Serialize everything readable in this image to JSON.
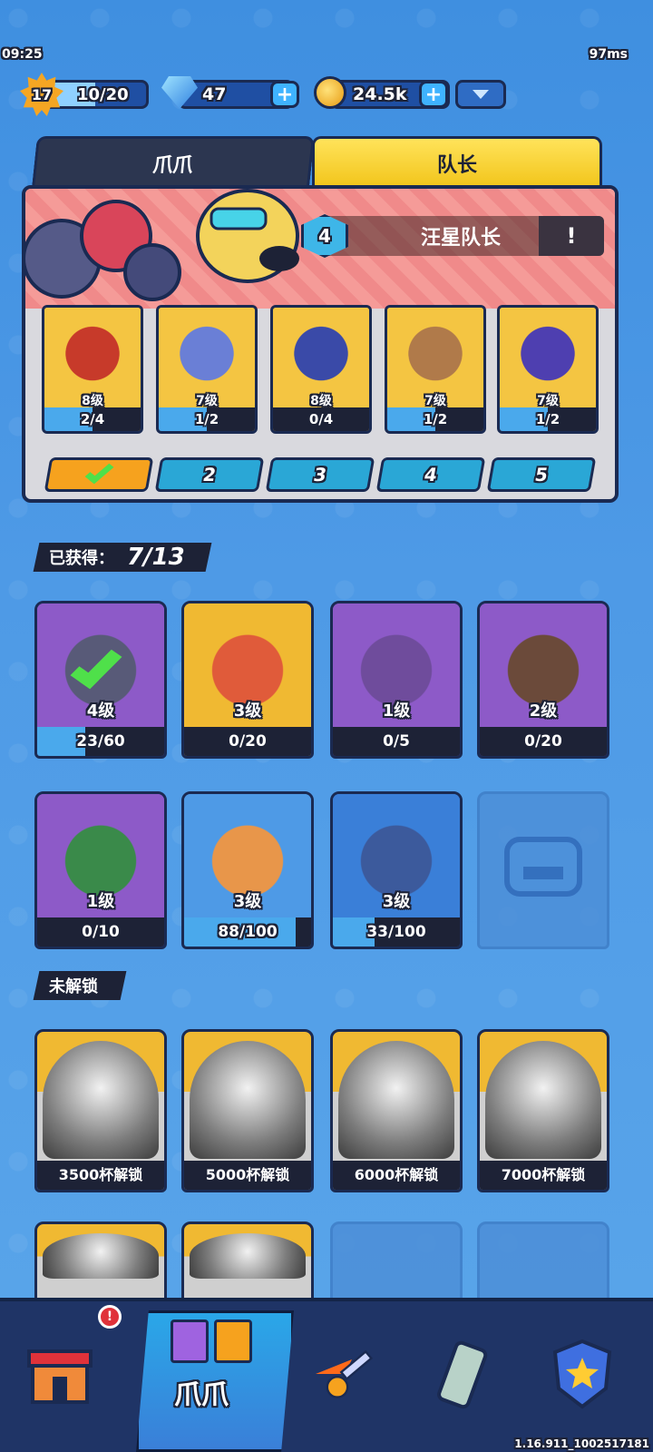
{
  "status": {
    "time": "09:25",
    "ping": "97ms"
  },
  "topbar": {
    "level": "17",
    "xp": "10/20",
    "xp_fraction": 0.5,
    "gems": "47",
    "coins": "24.5k"
  },
  "tabs": {
    "claw": "爪爪",
    "captain": "队长"
  },
  "captain": {
    "badge": "4",
    "name": "汪星队长",
    "info": "!"
  },
  "squad": [
    {
      "level": "8级",
      "progress": "2/4",
      "fraction": 0.5,
      "color": "#c73a2a"
    },
    {
      "level": "7级",
      "progress": "1/2",
      "fraction": 0.5,
      "color": "#6a7fd6"
    },
    {
      "level": "8级",
      "progress": "0/4",
      "fraction": 0.0,
      "color": "#3a4aa8"
    },
    {
      "level": "7级",
      "progress": "1/2",
      "fraction": 0.5,
      "color": "#b07a4a"
    },
    {
      "level": "7级",
      "progress": "1/2",
      "fraction": 0.5,
      "color": "#4e3fb0"
    }
  ],
  "slots": [
    "",
    "2",
    "3",
    "4",
    "5"
  ],
  "owned": {
    "label": "已获得：",
    "count": "7/13",
    "cards": [
      {
        "level": "4级",
        "progress": "23/60",
        "fraction": 0.38,
        "top": "#8d5ac8",
        "art": "#585a78"
      },
      {
        "level": "3级",
        "progress": "0/20",
        "fraction": 0.0,
        "top": "#f0b932",
        "art": "#e05b3a"
      },
      {
        "level": "1级",
        "progress": "0/5",
        "fraction": 0.0,
        "top": "#8d5ac8",
        "art": "#6f4c9c"
      },
      {
        "level": "2级",
        "progress": "0/20",
        "fraction": 0.0,
        "top": "#8d5ac8",
        "art": "#6b4a3a"
      },
      {
        "level": "1级",
        "progress": "0/10",
        "fraction": 0.0,
        "top": "#8d5ac8",
        "art": "#3a8a4a"
      },
      {
        "level": "3级",
        "progress": "88/100",
        "fraction": 0.88,
        "top": "#4e9ae6",
        "art": "#e8964a"
      },
      {
        "level": "3级",
        "progress": "33/100",
        "fraction": 0.33,
        "top": "#3a7fd8",
        "art": "#3c5a9c"
      }
    ]
  },
  "locked": {
    "label": "未解锁",
    "cards": [
      {
        "label": "3500杯解锁"
      },
      {
        "label": "5000杯解锁"
      },
      {
        "label": "6000杯解锁"
      },
      {
        "label": "7000杯解锁"
      }
    ]
  },
  "nav": {
    "active_label": "爪爪",
    "alert": "!"
  },
  "version": "1.16.911_1002517181"
}
